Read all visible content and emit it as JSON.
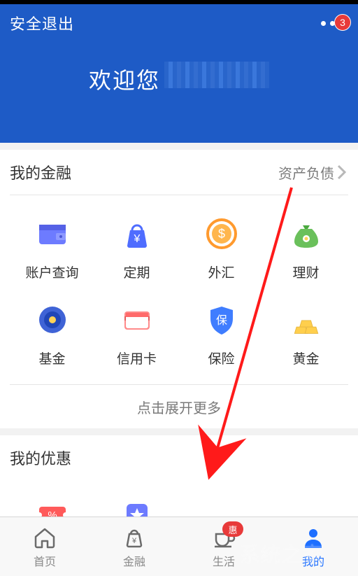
{
  "header": {
    "logout": "安全退出",
    "badge": "3",
    "welcome": "欢迎您"
  },
  "finance": {
    "title": "我的金融",
    "link": "资产负债",
    "items": [
      {
        "label": "账户查询",
        "icon": "wallet"
      },
      {
        "label": "定期",
        "icon": "bag-yen"
      },
      {
        "label": "外汇",
        "icon": "dollar-circle"
      },
      {
        "label": "理财",
        "icon": "money-bag"
      },
      {
        "label": "基金",
        "icon": "coin"
      },
      {
        "label": "信用卡",
        "icon": "credit-card"
      },
      {
        "label": "保险",
        "icon": "shield-bao"
      },
      {
        "label": "黄金",
        "icon": "gold-bars"
      }
    ],
    "more": "点击展开更多"
  },
  "promo": {
    "title": "我的优惠",
    "items": [
      {
        "label": "",
        "icon": "coupon"
      },
      {
        "label": "",
        "icon": "star-badge"
      }
    ]
  },
  "nav": {
    "items": [
      {
        "label": "首页",
        "icon": "home",
        "active": false
      },
      {
        "label": "金融",
        "icon": "bag",
        "active": false
      },
      {
        "label": "生活",
        "icon": "cup",
        "active": false,
        "badge": "惠"
      },
      {
        "label": "我的",
        "icon": "person",
        "active": true
      }
    ]
  },
  "colors": {
    "brand": "#1e5bc6",
    "accent": "#e83a3a",
    "active": "#1e6fff"
  }
}
